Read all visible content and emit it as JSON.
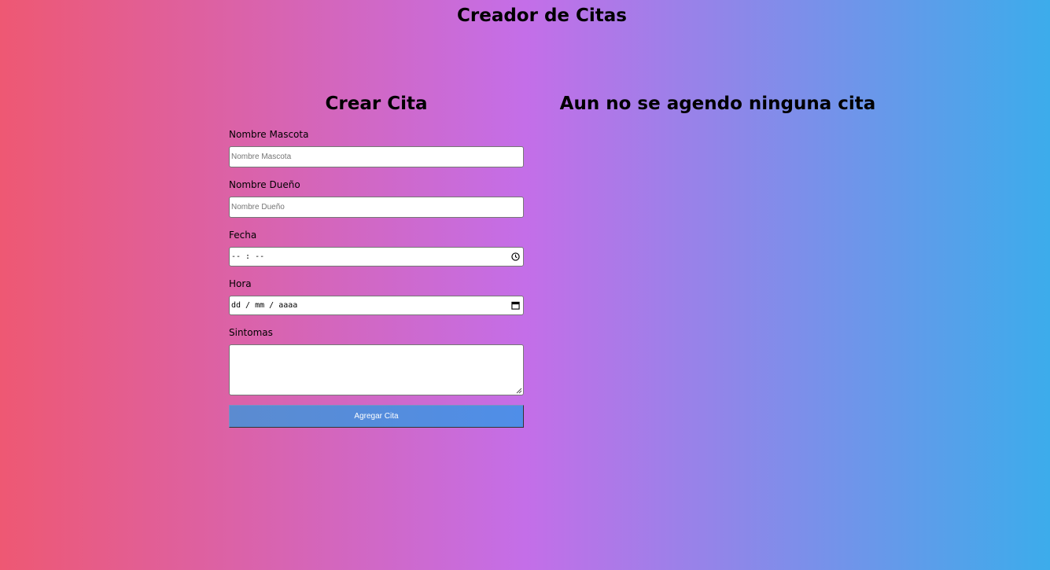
{
  "header": {
    "title": "Creador de Citas"
  },
  "form": {
    "title": "Crear Cita",
    "fields": {
      "pet_name": {
        "label": "Nombre Mascota",
        "placeholder": "Nombre Mascota"
      },
      "owner_name": {
        "label": "Nombre Dueño",
        "placeholder": "Nombre Dueño"
      },
      "date": {
        "label": "Fecha",
        "value": "-- : --",
        "icon": "clock-icon"
      },
      "time": {
        "label": "Hora",
        "value": "dd / mm / aaaa",
        "icon": "calendar-icon"
      },
      "symptoms": {
        "label": "Sintomas",
        "value": ""
      }
    },
    "submit_label": "Agregar Cita"
  },
  "appointments": {
    "empty_message": "Aun no se agendo ninguna cita"
  },
  "colors": {
    "gradient_left": "#ee5873",
    "gradient_mid": "#c46ee8",
    "gradient_right": "#3caceb",
    "button": "#5b8bd0"
  }
}
